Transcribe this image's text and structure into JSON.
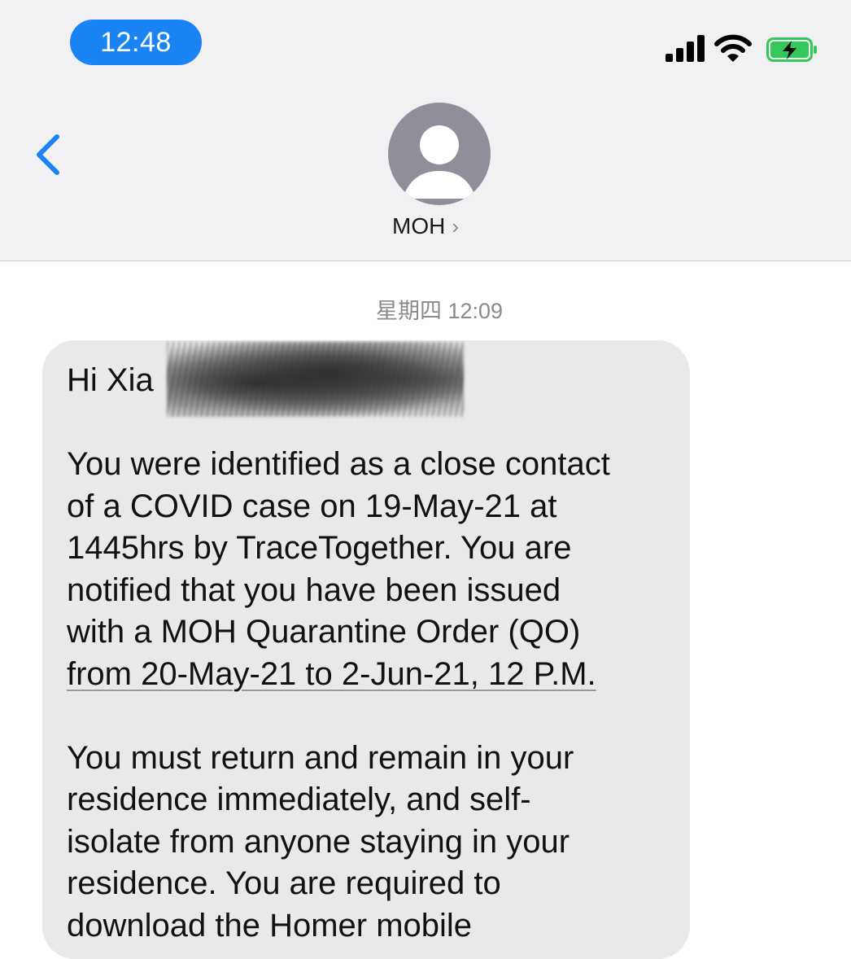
{
  "status_bar": {
    "time": "12:48",
    "icons": [
      "cellular-signal-icon",
      "wifi-icon",
      "battery-charging-icon"
    ],
    "accent_color": "#1a84f5",
    "battery_color": "#34c759"
  },
  "nav": {
    "back_icon": "chevron-left-icon",
    "contact_name": "MOH",
    "contact_chevron": "›"
  },
  "conversation": {
    "timestamp": "星期四 12:09",
    "message": {
      "greeting": "Hi Xia",
      "paragraph1_lines": [
        "You were identified as a close contact",
        "of a COVID case on 19-May-21 at",
        "1445hrs by TraceTogether. You are",
        "notified that you have been issued",
        "with a MOH Quarantine Order (QO)",
        "from 20-May-21 to 2-Jun-21, 12 P.M."
      ],
      "paragraph2_lines": [
        "You must return and remain in your",
        "residence immediately, and self-",
        "isolate from anyone staying in your",
        "residence. You are required to",
        "download the Homer mobile"
      ]
    }
  }
}
